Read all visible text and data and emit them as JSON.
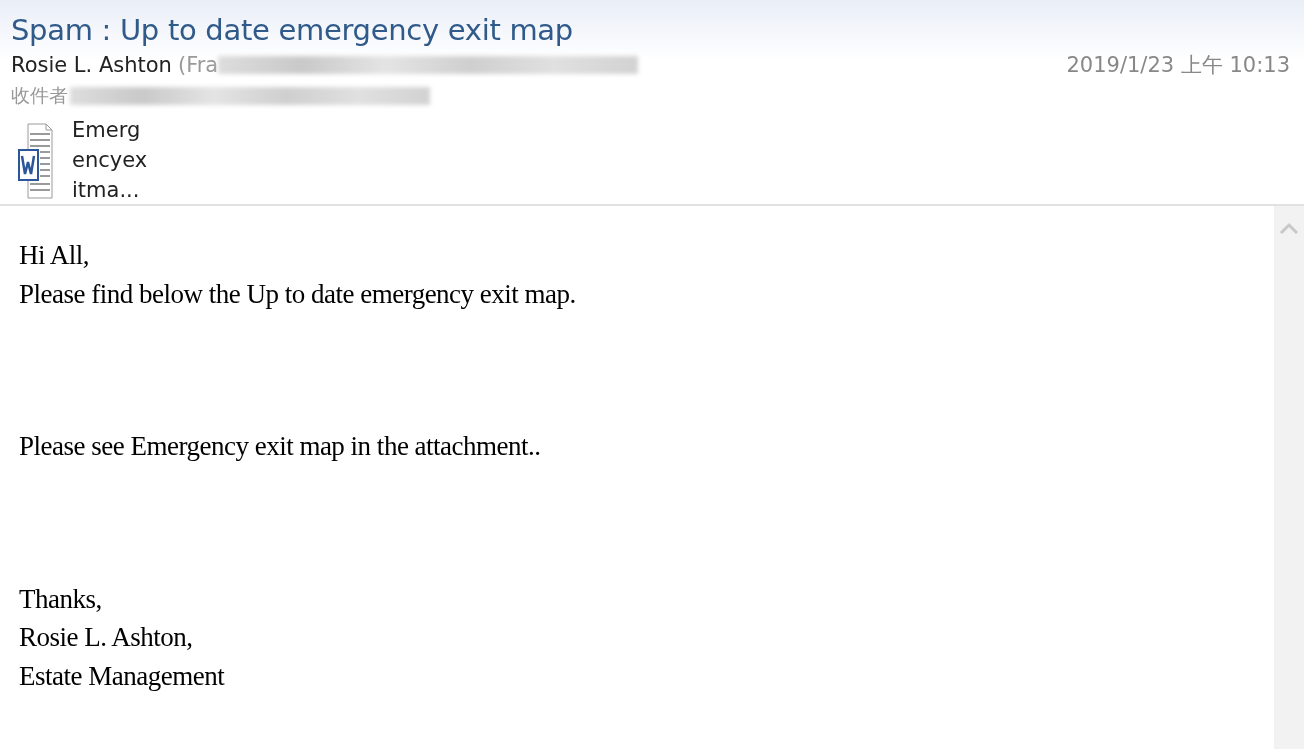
{
  "header": {
    "subject": "Spam : Up to date emergency exit map",
    "sender": "Rosie L. Ashton",
    "sender_address_start": "(Fra",
    "date": "2019/1/23 上午 10:13",
    "to_label": "收件者"
  },
  "attachments": [
    {
      "kind": "word",
      "name_lines": [
        "Emerg",
        "encyex",
        "itma..."
      ]
    }
  ],
  "body": {
    "paragraphs": [
      [
        "Hi All,",
        "Please find below the Up to date emergency exit map."
      ],
      [
        "Please see Emergency exit map in the attachment.."
      ],
      [
        "Thanks,",
        "Rosie L. Ashton,",
        "Estate Management"
      ]
    ]
  }
}
